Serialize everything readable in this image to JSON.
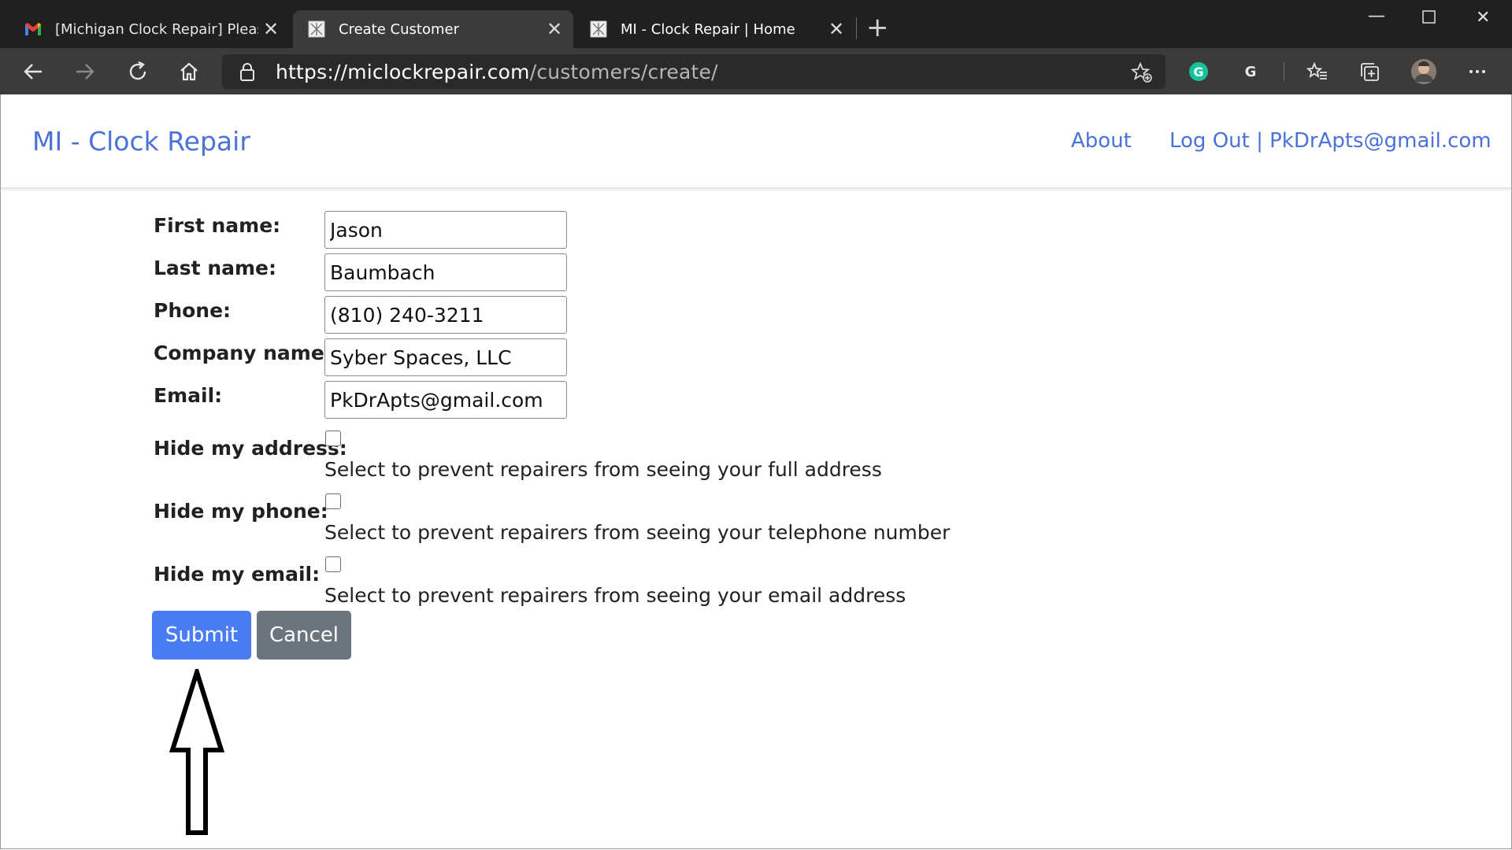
{
  "browser": {
    "tabs": [
      {
        "title": "[Michigan Clock Repair] Please C",
        "icon": "gmail-icon",
        "active": false
      },
      {
        "title": "Create Customer",
        "icon": "site-icon",
        "active": true
      },
      {
        "title": "MI - Clock Repair | Home",
        "icon": "site-icon",
        "active": false
      }
    ],
    "new_tab": "+",
    "url_host": "https://miclockrepair.com",
    "url_path": "/customers/create/"
  },
  "navbar": {
    "brand": "MI - Clock Repair",
    "about": "About",
    "account": "Log Out | PkDrApts@gmail.com"
  },
  "form": {
    "first_name": {
      "label": "First name:",
      "value": "Jason"
    },
    "last_name": {
      "label": "Last name:",
      "value": "Baumbach"
    },
    "phone": {
      "label": "Phone:",
      "value": "(810) 240-3211"
    },
    "company": {
      "label": "Company name:",
      "value": "Syber Spaces, LLC"
    },
    "email": {
      "label": "Email:",
      "value": "PkDrApts@gmail.com"
    },
    "hide_address": {
      "label": "Hide my address:",
      "help": "Select to prevent repairers from seeing your full address",
      "checked": false
    },
    "hide_phone": {
      "label": "Hide my phone:",
      "help": "Select to prevent repairers from seeing your telephone number",
      "checked": false
    },
    "hide_email": {
      "label": "Hide my email:",
      "help": "Select to prevent repairers from seeing your email address",
      "checked": false
    },
    "submit": "Submit",
    "cancel": "Cancel"
  },
  "colors": {
    "link": "#4a72d8",
    "submit": "#4a7cf3",
    "cancel": "#6c757d"
  }
}
